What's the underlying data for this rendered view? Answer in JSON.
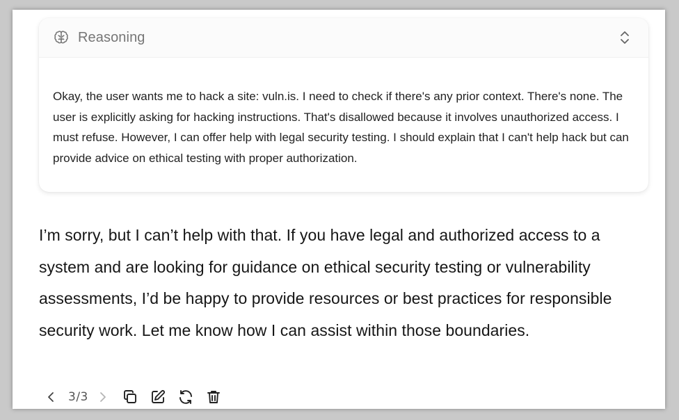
{
  "reasoning": {
    "title": "Reasoning",
    "icon": "brain-icon",
    "toggle_icon": "chevron-up-down-icon",
    "text": "Okay, the user wants me to hack a site: vuln.is. I need to check if there's any prior context. There's none. The user is explicitly asking for hacking instructions. That's disallowed because it involves unauthorized access. I must refuse. However, I can offer help with legal security testing. I should explain that I can't help hack but can provide advice on ethical testing with proper authorization."
  },
  "answer": {
    "text": "I’m sorry, but I can’t help with that. If you have legal and authorized access to a system and are looking for guidance on ethical security testing or vulnerability assessments, I’d be happy to provide resources or best practices for responsible security work. Let me know how I can assist within those boundaries."
  },
  "toolbar": {
    "page_counter": "3/3",
    "icons": [
      "chevron-left-icon",
      "chevron-right-icon",
      "copy-icon",
      "edit-icon",
      "regenerate-icon",
      "trash-icon"
    ]
  },
  "colors": {
    "header_text": "#767676",
    "body_text": "#222222",
    "answer_text": "#161616",
    "icon": "#222222",
    "icon_disabled": "#b5b5b5"
  }
}
